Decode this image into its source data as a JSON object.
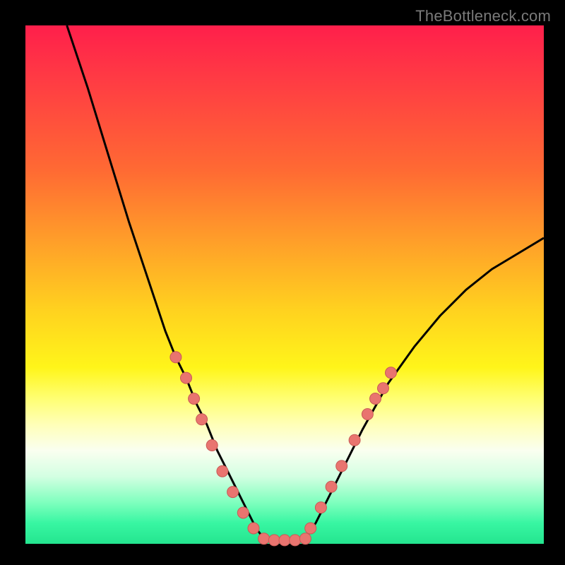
{
  "watermark": "TheBottleneck.com",
  "chart_data": {
    "type": "line",
    "title": "",
    "xlabel": "",
    "ylabel": "",
    "xlim": [
      0,
      100
    ],
    "ylim": [
      0,
      100
    ],
    "series": [
      {
        "name": "left-curve",
        "x": [
          8,
          12,
          16,
          20,
          24,
          27,
          29,
          31,
          33,
          35,
          37,
          39,
          41,
          43,
          44.5,
          46
        ],
        "values": [
          100,
          88,
          75,
          62,
          50,
          41,
          36,
          32,
          27,
          23,
          18,
          14,
          10,
          6,
          3,
          1
        ]
      },
      {
        "name": "bottom-flat",
        "x": [
          46,
          48,
          50,
          52,
          54
        ],
        "values": [
          1,
          0.5,
          0.5,
          0.5,
          1
        ]
      },
      {
        "name": "right-curve",
        "x": [
          54,
          56,
          58,
          60,
          62,
          65,
          70,
          75,
          80,
          85,
          90,
          95,
          100
        ],
        "values": [
          1,
          4,
          8,
          12,
          16,
          22,
          31,
          38,
          44,
          49,
          53,
          56,
          59
        ]
      }
    ],
    "markers": [
      {
        "series": "left-markers",
        "points": [
          {
            "x": 29,
            "y": 36
          },
          {
            "x": 31,
            "y": 32
          },
          {
            "x": 32.5,
            "y": 28
          },
          {
            "x": 34,
            "y": 24
          },
          {
            "x": 36,
            "y": 19
          },
          {
            "x": 38,
            "y": 14
          },
          {
            "x": 40,
            "y": 10
          },
          {
            "x": 42,
            "y": 6
          },
          {
            "x": 44,
            "y": 3
          }
        ]
      },
      {
        "series": "bottom-markers",
        "points": [
          {
            "x": 46,
            "y": 1
          },
          {
            "x": 48,
            "y": 0.7
          },
          {
            "x": 50,
            "y": 0.7
          },
          {
            "x": 52,
            "y": 0.7
          },
          {
            "x": 54,
            "y": 1
          }
        ]
      },
      {
        "series": "right-markers",
        "points": [
          {
            "x": 55,
            "y": 3
          },
          {
            "x": 57,
            "y": 7
          },
          {
            "x": 59,
            "y": 11
          },
          {
            "x": 61,
            "y": 15
          },
          {
            "x": 63.5,
            "y": 20
          },
          {
            "x": 66,
            "y": 25
          },
          {
            "x": 67.5,
            "y": 28
          },
          {
            "x": 69,
            "y": 30
          },
          {
            "x": 70.5,
            "y": 33
          }
        ]
      }
    ],
    "colors": {
      "curve": "#000000",
      "marker_fill": "#e9746f",
      "marker_stroke": "#c85a56"
    }
  }
}
